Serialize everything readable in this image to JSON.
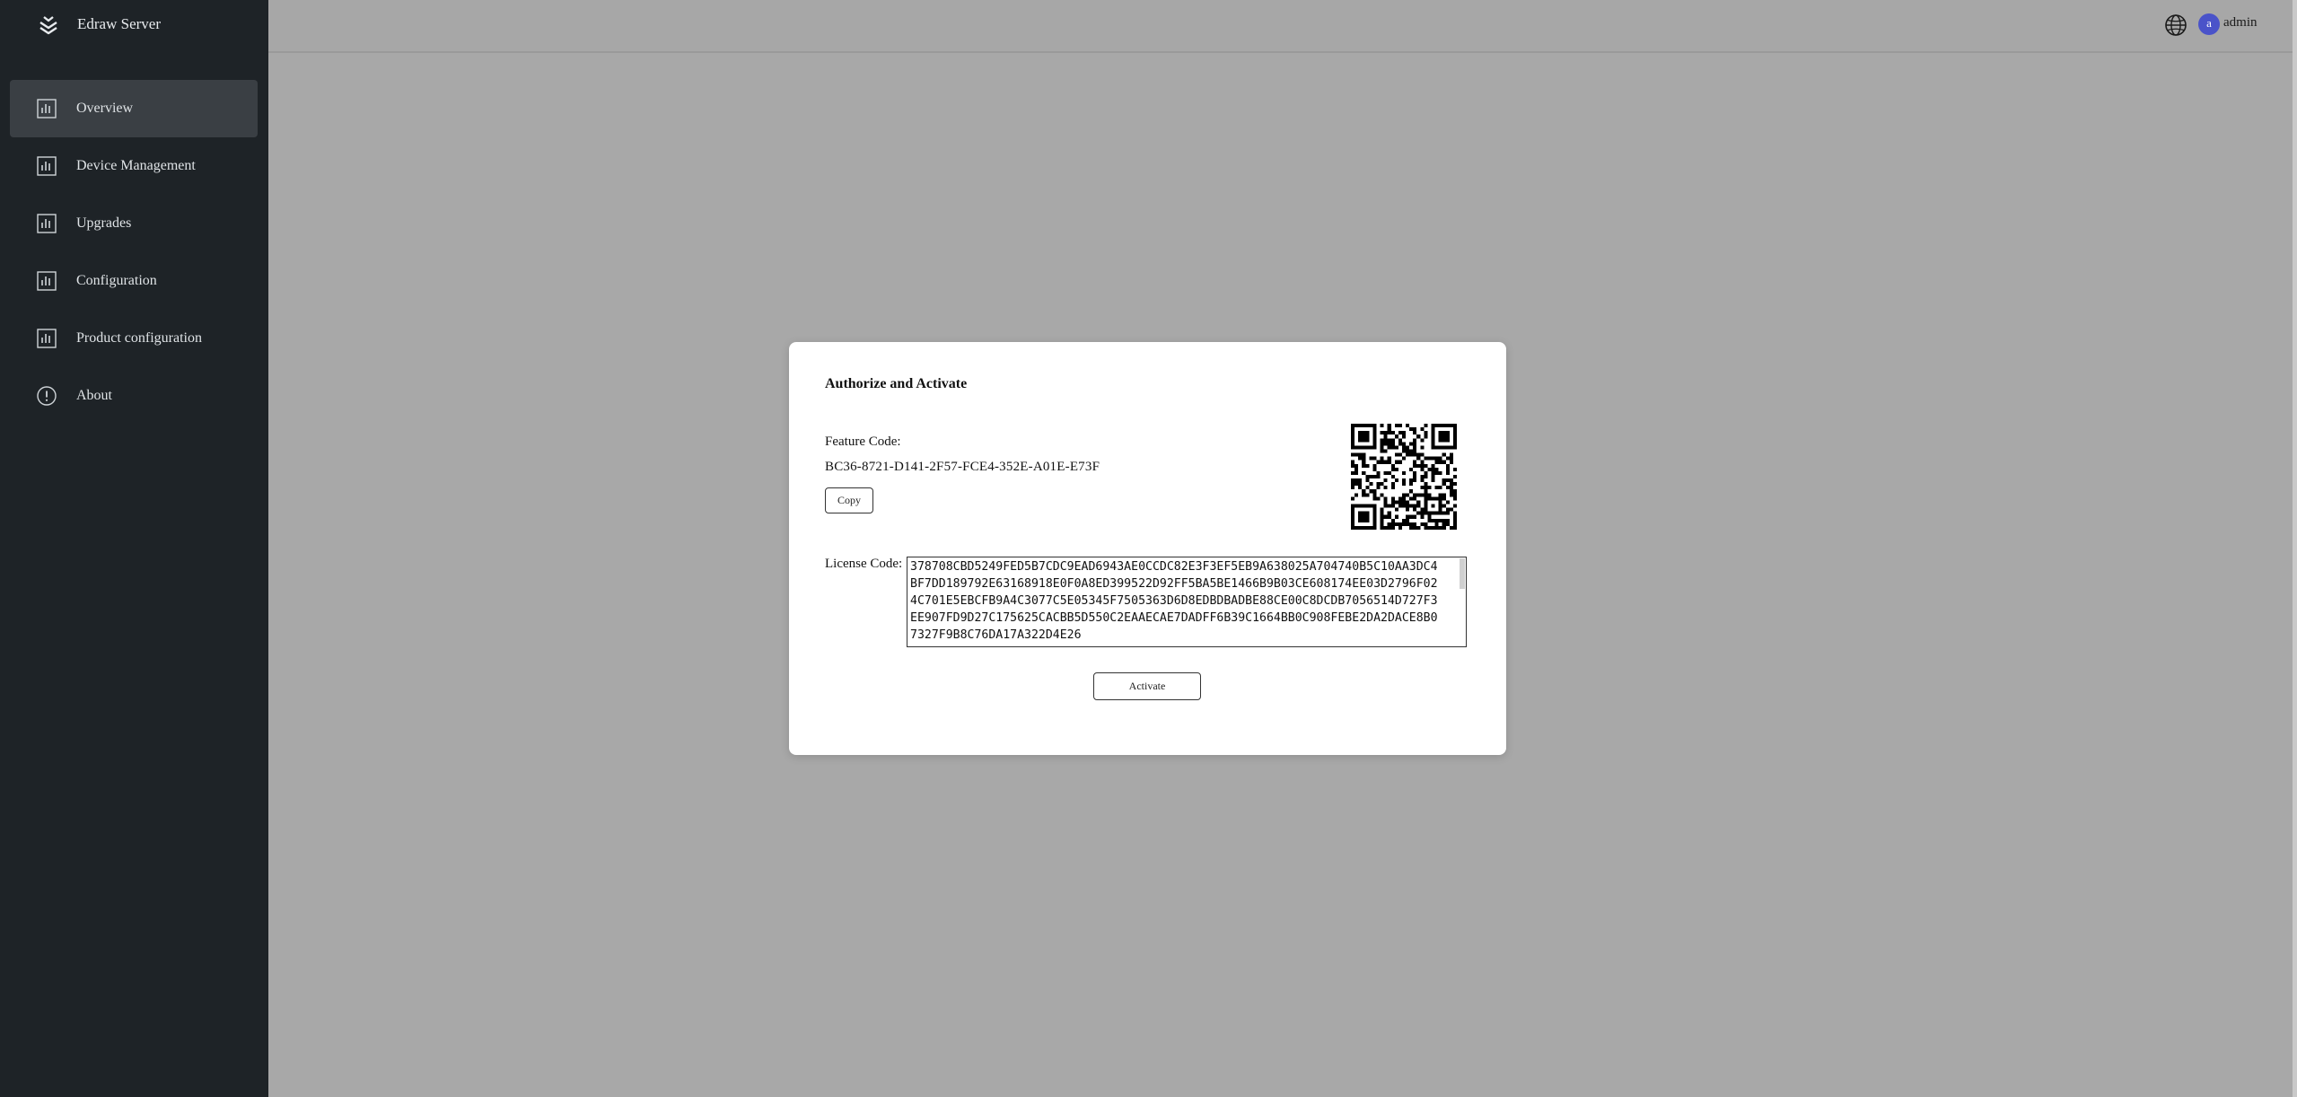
{
  "app": {
    "name": "Edraw Server"
  },
  "sidebar": {
    "items": [
      {
        "label": "Overview",
        "icon": "bar-chart-icon",
        "active": true
      },
      {
        "label": "Device Management",
        "icon": "bar-chart-icon",
        "active": false
      },
      {
        "label": "Upgrades",
        "icon": "bar-chart-icon",
        "active": false
      },
      {
        "label": "Configuration",
        "icon": "bar-chart-icon",
        "active": false
      },
      {
        "label": "Product configuration",
        "icon": "bar-chart-icon",
        "active": false
      },
      {
        "label": "About",
        "icon": "info-circle-icon",
        "active": false
      }
    ]
  },
  "header": {
    "language_icon": "globe-icon",
    "avatar_letter": "a",
    "username": "admin",
    "avatar_color": "#4a53c9"
  },
  "modal": {
    "title": "Authorize and Activate",
    "feature_label": "Feature Code:",
    "feature_code": "BC36-8721-D141-2F57-FCE4-352E-A01E-E73F",
    "copy_label": "Copy",
    "qr_icon": "qr-code-icon",
    "license_label": "License Code:",
    "license_code": "378708CBD5249FED5B7CDC9EAD6943AE0CCDC82E3F3EF5EB9A638025A704740B5C10AA3DC4BF7DD189792E63168918E0F0A8ED399522D92FF5BA5BE1466B9B03CE608174EE03D2796F024C701E5EBCFB9A4C3077C5E05345F7505363D6D8EDBDBADBE88CE00C8DCDB7056514D727F3EE907FD9D27C175625CACBB5D550C2EAAECAE7DADFF6B39C1664BB0C908FEBE2DA2DACE8B07327F9B8C76DA17A322D4E26",
    "activate_label": "Activate"
  },
  "colors": {
    "sidebar_bg": "#1e2327",
    "overlay": "#a8a8a8",
    "modal_bg": "#ffffff"
  }
}
